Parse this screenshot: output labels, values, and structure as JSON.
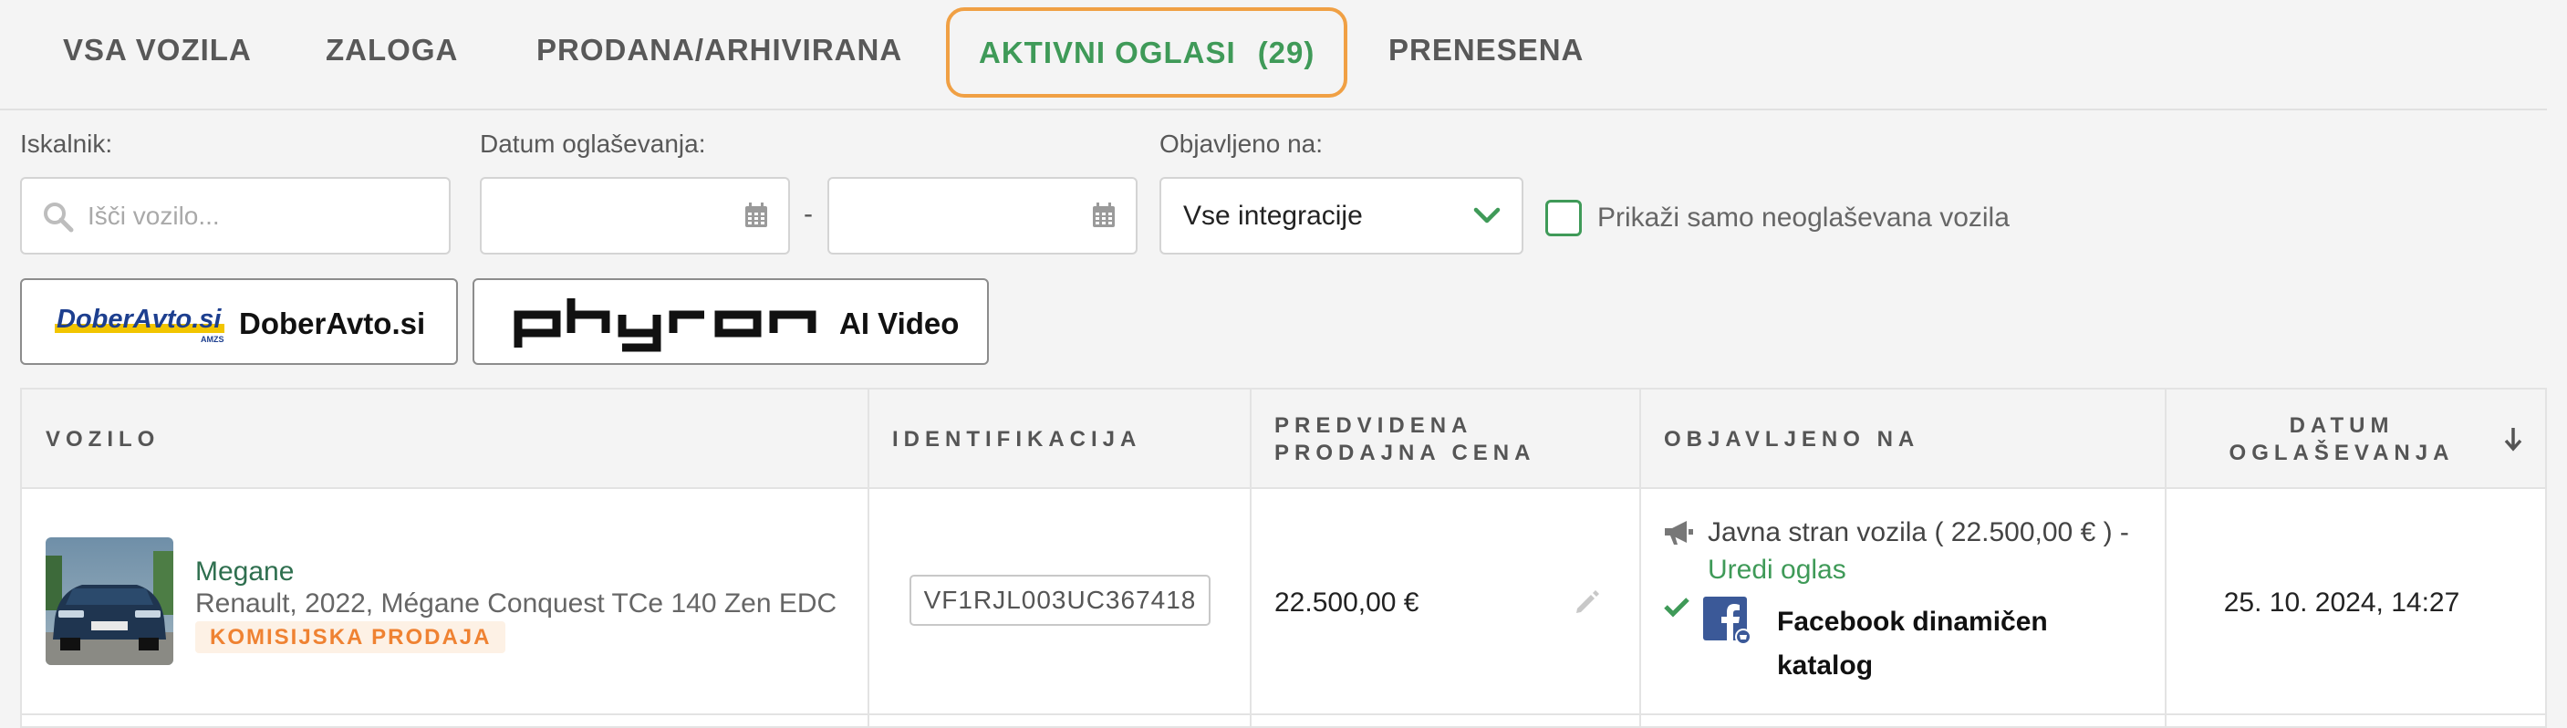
{
  "tabs": [
    {
      "label": "VSA VOZILA"
    },
    {
      "label": "ZALOGA"
    },
    {
      "label": "PRODANA/ARHIVIRANA"
    },
    {
      "label": "AKTIVNI OGLASI",
      "count": "(29)"
    },
    {
      "label": "PRENESENA"
    }
  ],
  "filters": {
    "search_label": "Iskalnik:",
    "search_placeholder": "Išči vozilo...",
    "date_label": "Datum oglaševanja:",
    "date_separator": "-",
    "date_from": "",
    "date_to": "",
    "published_label": "Objavljeno na:",
    "published_value": "Vse integracije",
    "only_unpublished_label": "Prikaži samo neoglaševana vozila",
    "only_unpublished_checked": false
  },
  "integrations": [
    {
      "logo_text": "DoberAvto.si",
      "logo_subtext": "AMZS",
      "label": "DoberAvto.si"
    },
    {
      "logo_text": "phyron",
      "label": "AI Video"
    }
  ],
  "table": {
    "headers": {
      "vehicle": "VOZILO",
      "identification": "IDENTIFIKACIJA",
      "price_line1": "PREDVIDENA",
      "price_line2": "PRODAJNA CENA",
      "published": "OBJAVLJENO NA",
      "date_line1": "DATUM",
      "date_line2": "OGLAŠEVANJA"
    },
    "sort_direction": "descending",
    "rows": [
      {
        "model": "Megane",
        "description": "Renault, 2022, Mégane Conquest TCe 140 Zen EDC",
        "badge": "KOMISIJSKA PRODAJA",
        "vin": "VF1RJL003UC367418",
        "price": "22.500,00 €",
        "public_page": "Javna stran vozila ( 22.500,00 € ) -",
        "edit_link": "Uredi oglas",
        "facebook": "Facebook dinamičen katalog",
        "date": "25. 10. 2024, 14:27"
      }
    ]
  },
  "colors": {
    "accent_green": "#3f9a58",
    "active_tab_border": "#f0a044",
    "badge_orange": "#ef8232",
    "facebook_blue": "#3b5998"
  },
  "icons": [
    "search-icon",
    "calendar-icon",
    "chevron-down-icon",
    "megaphone-icon",
    "check-icon",
    "facebook-icon",
    "pencil-icon",
    "sort-arrow-down-icon"
  ]
}
